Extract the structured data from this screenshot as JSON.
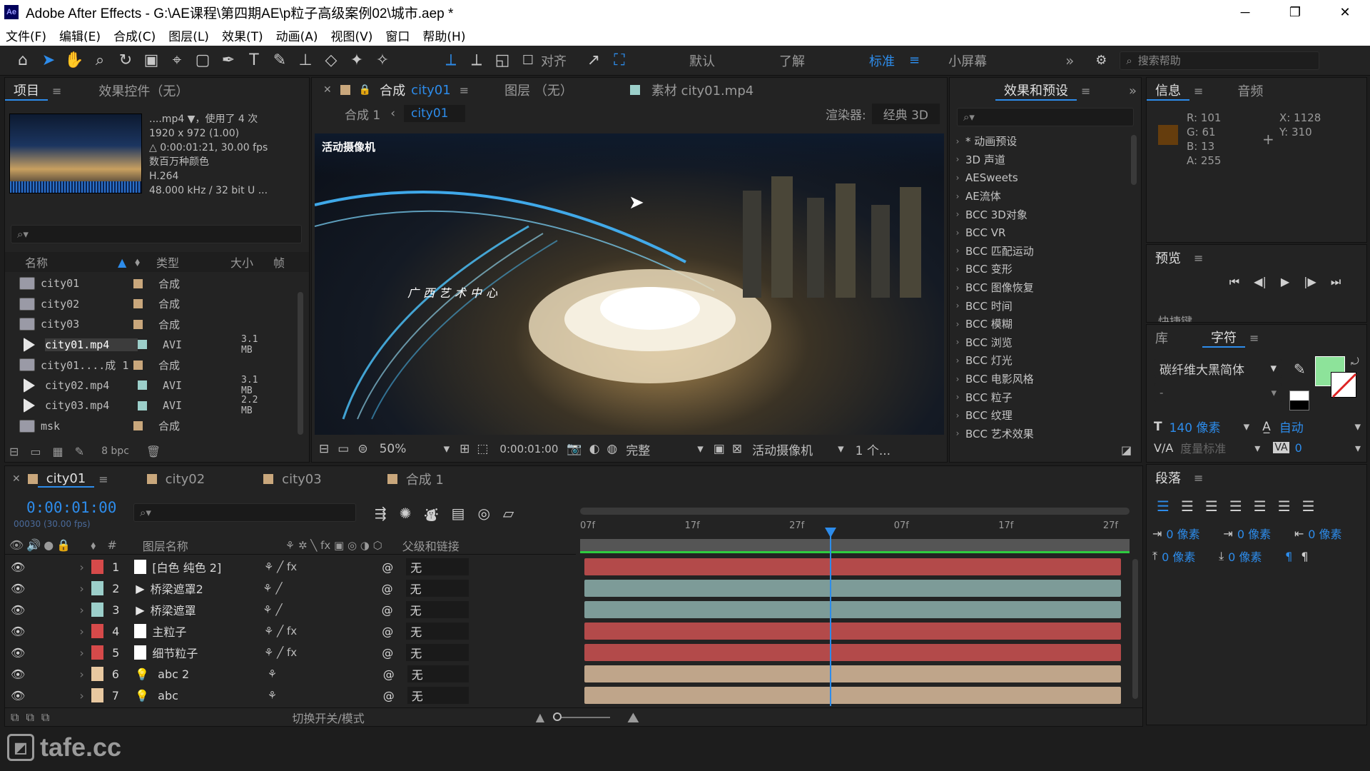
{
  "titlebar": {
    "title": "Adobe After Effects - G:\\AE课程\\第四期AE\\p粒子高级案例02\\城市.aep *",
    "app_icon": "Ae",
    "minimize": "─",
    "restore": "❐",
    "close": "✕"
  },
  "menu": [
    "文件(F)",
    "编辑(E)",
    "合成(C)",
    "图层(L)",
    "效果(T)",
    "动画(A)",
    "视图(V)",
    "窗口",
    "帮助(H)"
  ],
  "toolbar": {
    "snap_label": "对齐",
    "workspaces": [
      "默认",
      "了解",
      "标准",
      "小屏幕"
    ],
    "active_workspace": "标准",
    "search_placeholder": "搜索帮助"
  },
  "project_panel": {
    "tabs": [
      "项目",
      "效果控件（无）"
    ],
    "preview": {
      "name": "....mp4 ▼，使用了 4 次",
      "dims": "1920 x 972 (1.00)",
      "duration": "△ 0:00:01:21, 30.00 fps",
      "colors": "数百万种颜色",
      "codec": "H.264",
      "audio": "48.000 kHz / 32 bit U ..."
    },
    "columns": [
      "名称",
      "类型",
      "大小",
      "帧"
    ],
    "items": [
      {
        "name": "city01",
        "type": "合成",
        "size": "",
        "kind": "comp",
        "label_color": "#c9a77c"
      },
      {
        "name": "city02",
        "type": "合成",
        "size": "",
        "kind": "comp",
        "label_color": "#c9a77c"
      },
      {
        "name": "city03",
        "type": "合成",
        "size": "",
        "kind": "comp",
        "label_color": "#c9a77c"
      },
      {
        "name": "city01.mp4",
        "type": "AVI",
        "size": "3.1 MB",
        "kind": "footage",
        "label_color": "#9ccfca",
        "selected": true
      },
      {
        "name": "city01....成 1",
        "type": "合成",
        "size": "",
        "kind": "comp",
        "label_color": "#c9a77c"
      },
      {
        "name": "city02.mp4",
        "type": "AVI",
        "size": "3.1 MB",
        "kind": "footage",
        "label_color": "#9ccfca"
      },
      {
        "name": "city03.mp4",
        "type": "AVI",
        "size": "2.2 MB",
        "kind": "footage",
        "label_color": "#9ccfca"
      },
      {
        "name": "msk",
        "type": "合成",
        "size": "",
        "kind": "comp",
        "label_color": "#c9a77c"
      }
    ],
    "bpc": "8 bpc"
  },
  "comp_panel": {
    "tabs": {
      "comp_label": "合成",
      "comp_name": "city01",
      "layer": "图层 （无）",
      "footage": "素材 city01.mp4"
    },
    "breadcrumb": [
      "合成 1",
      "city01"
    ],
    "renderer_label": "渲染器:",
    "renderer": "经典 3D",
    "camera_label": "活动摄像机",
    "overlay_text": "广西艺术中心",
    "zoom": "50%",
    "timecode": "0:00:01:00",
    "quality": "完整",
    "camera_select": "活动摄像机",
    "views": "1 个..."
  },
  "effects_panel": {
    "title": "效果和预设",
    "items": [
      "* 动画预设",
      "3D 声道",
      "AESweets",
      "AE流体",
      "BCC 3D对象",
      "BCC VR",
      "BCC 匹配运动",
      "BCC 变形",
      "BCC 图像恢复",
      "BCC 时间",
      "BCC 模糊",
      "BCC 浏览",
      "BCC 灯光",
      "BCC 电影风格",
      "BCC 粒子",
      "BCC 纹理",
      "BCC 艺术效果"
    ]
  },
  "info_panel": {
    "tabs": [
      "信息",
      "音频"
    ],
    "r": "R: 101",
    "g": "G: 61",
    "b": "B: 13",
    "a": "A: 255",
    "x": "X: 1128",
    "y": "Y: 310",
    "swatch": "#653d0d"
  },
  "preview_panel": {
    "title": "预览",
    "shortcut_partial": "快捷键"
  },
  "char_panel": {
    "tabs": [
      "库",
      "字符"
    ],
    "font": "碳纤维大黑简体",
    "style": "-",
    "size": "140 像素",
    "leading": "自动",
    "kerning": "度量标准",
    "tracking": "0",
    "fill_color": "#8de39a"
  },
  "para_panel": {
    "title": "段落",
    "indent_left": "0 像素",
    "indent_first": "0 像素",
    "indent_right": "0 像素",
    "space_before": "0 像素",
    "space_after": "0 像素"
  },
  "timeline": {
    "tabs": [
      "city01",
      "city02",
      "city03",
      "合成 1"
    ],
    "timecode": "0:00:01:00",
    "frame_info": "00030 (30.00 fps)",
    "columns": {
      "num": "#",
      "name": "图层名称",
      "parent": "父级和链接"
    },
    "ruler": [
      "07f",
      "17f",
      "27f",
      "07f",
      "17f",
      "27f"
    ],
    "layers": [
      {
        "num": "1",
        "name": "[白色 纯色 2]",
        "parent": "无",
        "color": "#d64a4a",
        "bar": "#b34a4a",
        "fx": true
      },
      {
        "num": "2",
        "name": "桥梁遮罩2",
        "parent": "无",
        "color": "#9ccfca",
        "bar": "#7d9b98",
        "fx": false
      },
      {
        "num": "3",
        "name": "桥梁遮罩",
        "parent": "无",
        "color": "#9ccfca",
        "bar": "#7d9b98",
        "fx": false
      },
      {
        "num": "4",
        "name": "主粒子",
        "parent": "无",
        "color": "#d64a4a",
        "bar": "#b34a4a",
        "fx": true
      },
      {
        "num": "5",
        "name": "细节粒子",
        "parent": "无",
        "color": "#d64a4a",
        "bar": "#b34a4a",
        "fx": true
      },
      {
        "num": "6",
        "name": "abc 2",
        "parent": "无",
        "color": "#e8c8a0",
        "bar": "#bfa58a",
        "fx": false
      },
      {
        "num": "7",
        "name": "abc",
        "parent": "无",
        "color": "#e8c8a0",
        "bar": "#bfa58a",
        "fx": false
      }
    ],
    "footer": "切换开关/模式",
    "playhead_fraction": 0.455
  },
  "watermark": "tafe.cc",
  "colors": {
    "accent": "#2d8ceb",
    "bg": "#232323"
  }
}
